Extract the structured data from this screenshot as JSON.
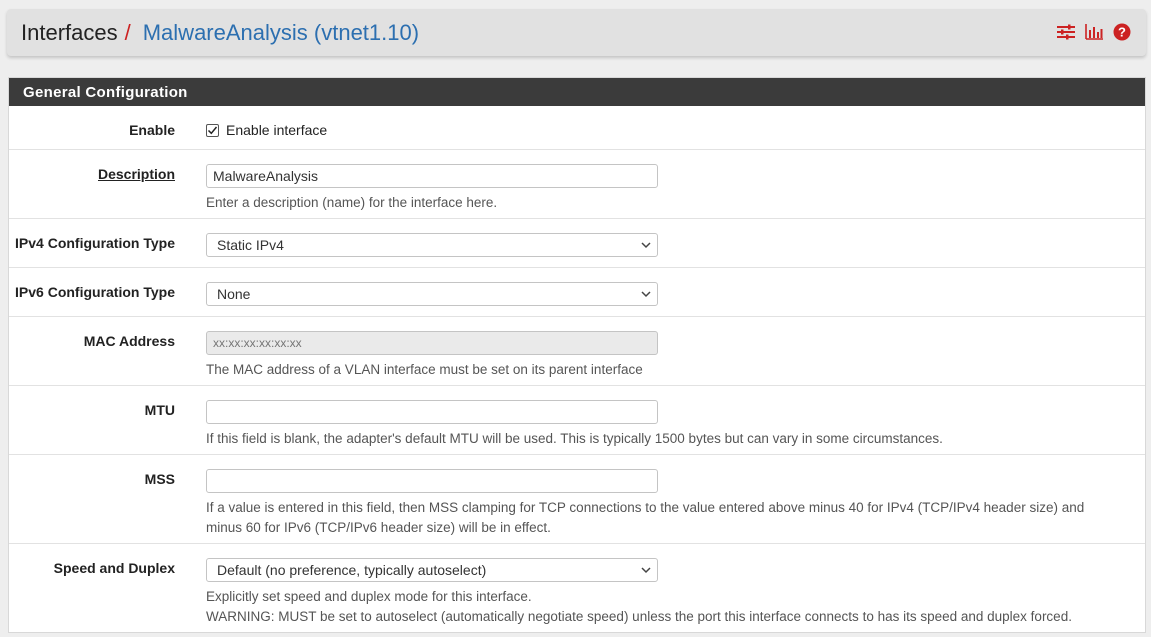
{
  "breadcrumb": {
    "root": "Interfaces",
    "separator": "/",
    "current": "MalwareAnalysis (vtnet1.10)",
    "icons": [
      "sliders-icon",
      "bar-chart-icon",
      "help-icon"
    ]
  },
  "panel": {
    "title": "General Configuration"
  },
  "form": {
    "enable": {
      "label": "Enable",
      "checkbox_label": "Enable interface",
      "checked": true
    },
    "description": {
      "label": "Description",
      "value": "MalwareAnalysis",
      "help": "Enter a description (name) for the interface here."
    },
    "ipv4_type": {
      "label": "IPv4 Configuration Type",
      "selected": "Static IPv4"
    },
    "ipv6_type": {
      "label": "IPv6 Configuration Type",
      "selected": "None"
    },
    "mac": {
      "label": "MAC Address",
      "placeholder": "xx:xx:xx:xx:xx:xx",
      "help": "The MAC address of a VLAN interface must be set on its parent interface"
    },
    "mtu": {
      "label": "MTU",
      "value": "",
      "help": "If this field is blank, the adapter's default MTU will be used. This is typically 1500 bytes but can vary in some circumstances."
    },
    "mss": {
      "label": "MSS",
      "value": "",
      "help_line1": "If a value is entered in this field, then MSS clamping for TCP connections to the value entered above minus 40 for IPv4 (TCP/IPv4 header size) and",
      "help_line2": "minus 60 for IPv6 (TCP/IPv6 header size) will be in effect."
    },
    "speed": {
      "label": "Speed and Duplex",
      "selected": "Default (no preference, typically autoselect)",
      "help_line1": "Explicitly set speed and duplex mode for this interface.",
      "help_line2": "WARNING: MUST be set to autoselect (automatically negotiate speed) unless the port this interface connects to has its speed and duplex forced."
    }
  },
  "colors": {
    "accent_red": "#cc2222",
    "link_blue": "#2c6fb0",
    "panel_heading": "#3b3b3b"
  }
}
